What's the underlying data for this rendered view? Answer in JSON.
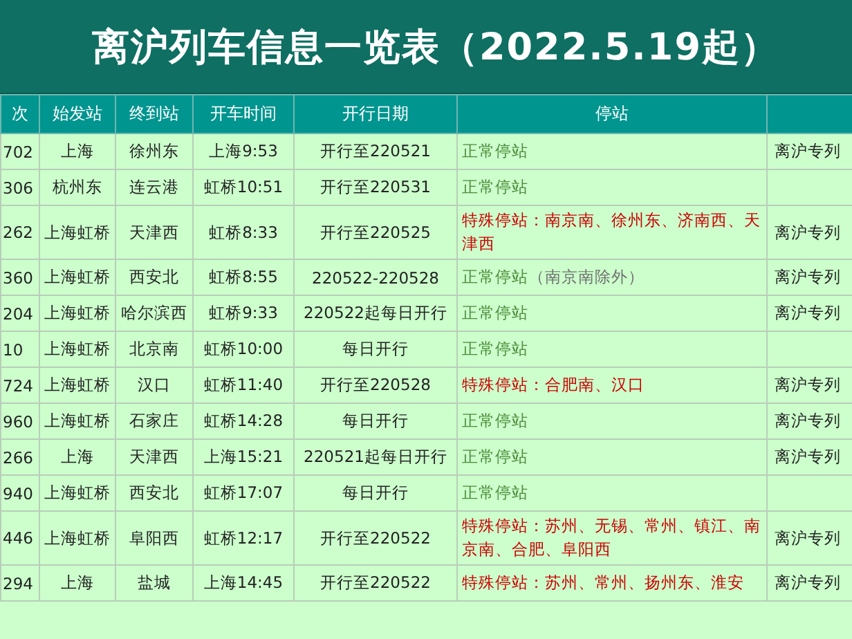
{
  "title": "离沪列车信息一览表（2022.5.19起）",
  "table": {
    "columns": [
      "次",
      "始发站",
      "终到站",
      "开车时间",
      "开行日期",
      "停站",
      ""
    ],
    "rows": [
      {
        "train": "702",
        "from": "上海",
        "to": "徐州东",
        "departs": "上海9:53",
        "dates": "开行至220521",
        "stops": {
          "kind": "normal",
          "text": "正常停站"
        },
        "column_7": "离沪专列"
      },
      {
        "train": "306",
        "from": "杭州东",
        "to": "连云港",
        "departs": "虹桥10:51",
        "dates": "开行至220531",
        "stops": {
          "kind": "normal",
          "text": "正常停站"
        }
      },
      {
        "train": "262",
        "from": "上海虹桥",
        "to": "天津西",
        "departs": "虹桥8:33",
        "dates": "开行至220525",
        "stops": {
          "kind": "special",
          "text": "特殊停站：南京南、徐州东、济南西、天津西"
        },
        "column_7": "离沪专列"
      },
      {
        "train": "360",
        "from": "上海虹桥",
        "to": "西安北",
        "departs": "虹桥8:55",
        "dates": "220522-220528",
        "stops": {
          "kind": "normal",
          "text": "正常停站",
          "note": "（南京南除外）"
        },
        "column_7": "离沪专列"
      },
      {
        "train": "204",
        "from": "上海虹桥",
        "to": "哈尔滨西",
        "departs": "虹桥9:33",
        "dates": "220522起每日开行",
        "stops": {
          "kind": "normal",
          "text": "正常停站"
        },
        "column_7": "离沪专列"
      },
      {
        "train": "10",
        "from": "上海虹桥",
        "to": "北京南",
        "departs": "虹桥10:00",
        "dates": "每日开行",
        "stops": {
          "kind": "normal",
          "text": "正常停站"
        }
      },
      {
        "train": "724",
        "from": "上海虹桥",
        "to": "汉口",
        "departs": "虹桥11:40",
        "dates": "开行至220528",
        "stops": {
          "kind": "special",
          "text": "特殊停站：合肥南、汉口"
        },
        "column_7": "离沪专列"
      },
      {
        "train": "960",
        "from": "上海虹桥",
        "to": "石家庄",
        "departs": "虹桥14:28",
        "dates": "每日开行",
        "stops": {
          "kind": "normal",
          "text": "正常停站"
        },
        "column_7": "离沪专列"
      },
      {
        "train": "266",
        "from": "上海",
        "to": "天津西",
        "departs": "上海15:21",
        "dates": "220521起每日开行",
        "stops": {
          "kind": "normal",
          "text": "正常停站"
        },
        "column_7": "离沪专列"
      },
      {
        "train": "940",
        "from": "上海虹桥",
        "to": "西安北",
        "departs": "虹桥17:07",
        "dates": "每日开行",
        "stops": {
          "kind": "normal",
          "text": "正常停站"
        }
      },
      {
        "train": "446",
        "from": "上海虹桥",
        "to": "阜阳西",
        "departs": "虹桥12:17",
        "dates": "开行至220522",
        "stops": {
          "kind": "special",
          "text": "特殊停站：苏州、无锡、常州、镇江、南京南、合肥、阜阳西"
        },
        "column_7": "离沪专列"
      },
      {
        "train": "294",
        "from": "上海",
        "to": "盐城",
        "departs": "上海14:45",
        "dates": "开行至220522",
        "stops": {
          "kind": "special",
          "text": "特殊停站：苏州、常州、扬州东、淮安"
        },
        "column_7": "离沪专列"
      }
    ]
  }
}
